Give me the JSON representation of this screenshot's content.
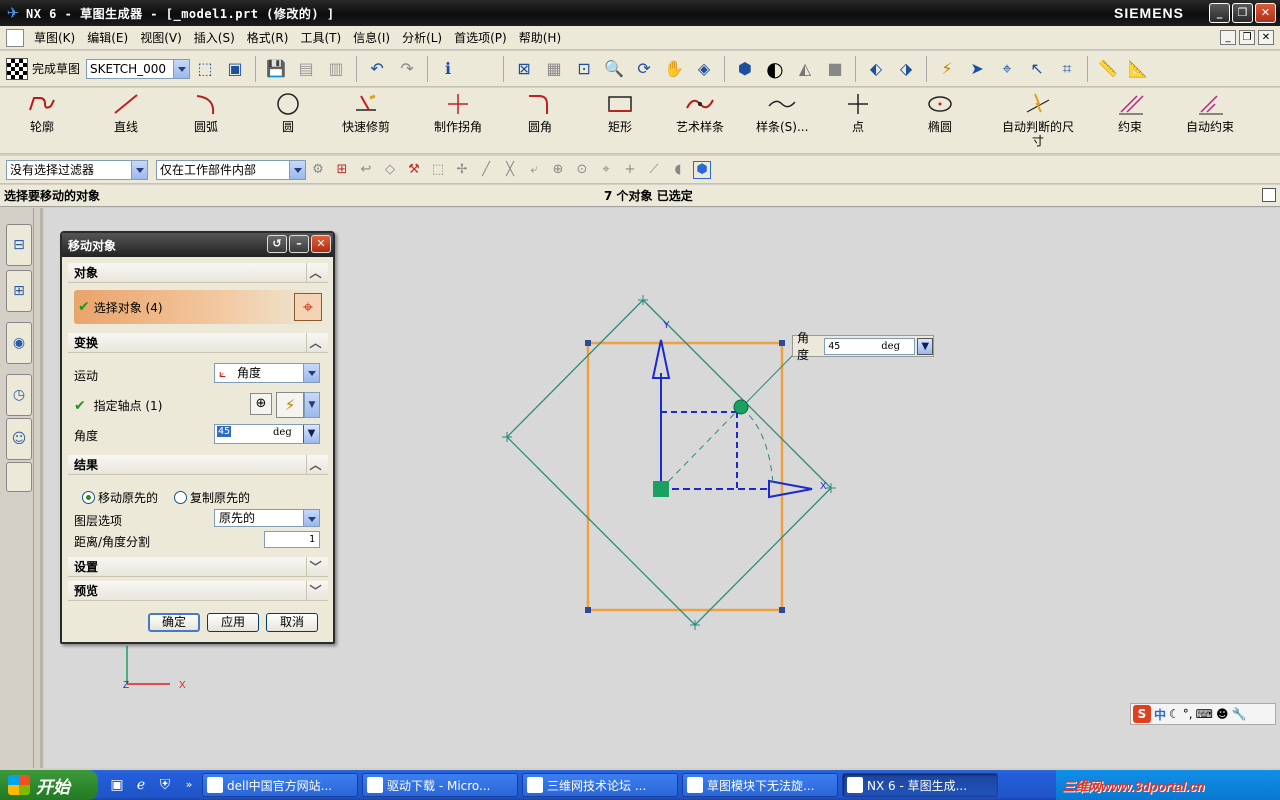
{
  "window": {
    "title": "NX 6 - 草图生成器 - [_model1.prt  (修改的) ]",
    "brand": "SIEMENS",
    "controls": [
      "_",
      "❐",
      "✕"
    ]
  },
  "menubar": {
    "items": [
      "草图(K)",
      "编辑(E)",
      "视图(V)",
      "插入(S)",
      "格式(R)",
      "工具(T)",
      "信息(I)",
      "分析(L)",
      "首选项(P)",
      "帮助(H)"
    ]
  },
  "toolbar1": {
    "finish_sketch_label": "完成草图",
    "sketch_name": "SKETCH_000"
  },
  "sketch_tools": [
    {
      "label": "轮廓",
      "icon": "profile-icon"
    },
    {
      "label": "直线",
      "icon": "line-icon"
    },
    {
      "label": "圆弧",
      "icon": "arc-icon"
    },
    {
      "label": "圆",
      "icon": "circle-icon"
    },
    {
      "label": "快速修剪",
      "icon": "quick-trim-icon"
    },
    {
      "label": "制作拐角",
      "icon": "make-corner-icon"
    },
    {
      "label": "圆角",
      "icon": "fillet-icon"
    },
    {
      "label": "矩形",
      "icon": "rectangle-icon"
    },
    {
      "label": "艺术样条",
      "icon": "studio-spline-icon"
    },
    {
      "label": "样条(S)...",
      "icon": "spline-icon"
    },
    {
      "label": "点",
      "icon": "point-icon"
    },
    {
      "label": "椭圆",
      "icon": "ellipse-icon"
    },
    {
      "label": "自动判断的尺寸",
      "icon": "inferred-dimension-icon"
    },
    {
      "label": "约束",
      "icon": "constraint-icon"
    },
    {
      "label": "自动约束",
      "icon": "auto-constrain-icon"
    }
  ],
  "selection_bar": {
    "type_filter": "没有选择过滤器",
    "scope": "仅在工作部件内部"
  },
  "status": {
    "prompt": "选择要移动的对象",
    "selection": "7 个对象 已选定"
  },
  "floating_input": {
    "label": "角度",
    "value": "45",
    "unit": "deg"
  },
  "dialog": {
    "title": "移动对象",
    "groups": {
      "objects": "对象",
      "transform": "变换",
      "result": "结果",
      "settings": "设置",
      "preview": "预览"
    },
    "select_objects": "选择对象  (4)",
    "motion_label": "运动",
    "motion_value": "角度",
    "pivot_label": "指定轴点  (1)",
    "angle_label": "角度",
    "angle_value": "45",
    "angle_unit": "deg",
    "move_original": "移动原先的",
    "copy_original": "复制原先的",
    "layer_label": "图层选项",
    "layer_value": "原先的",
    "divide_label": "距离/角度分割",
    "divide_value": "1",
    "ok": "确定",
    "apply": "应用",
    "cancel": "取消"
  },
  "canvas": {
    "triad_x": "X",
    "triad_z": "Z",
    "axis_x": "X",
    "axis_y": "Y",
    "colors": {
      "rectangle": "#f0a040",
      "rotated": "#2a8a7a",
      "handle": "#1a2acc",
      "pivot": "#1aa060"
    }
  },
  "ime": {
    "logo": "S",
    "label": "中"
  },
  "taskbar": {
    "start": "开始",
    "tasks": [
      "dell中国官方网站...",
      "驱动下载 - Micro...",
      "三维网技术论坛 ...",
      "草图模块下无法旋...",
      "NX 6 - 草图生成..."
    ],
    "watermark": "三维网www.3dportal.cn"
  }
}
